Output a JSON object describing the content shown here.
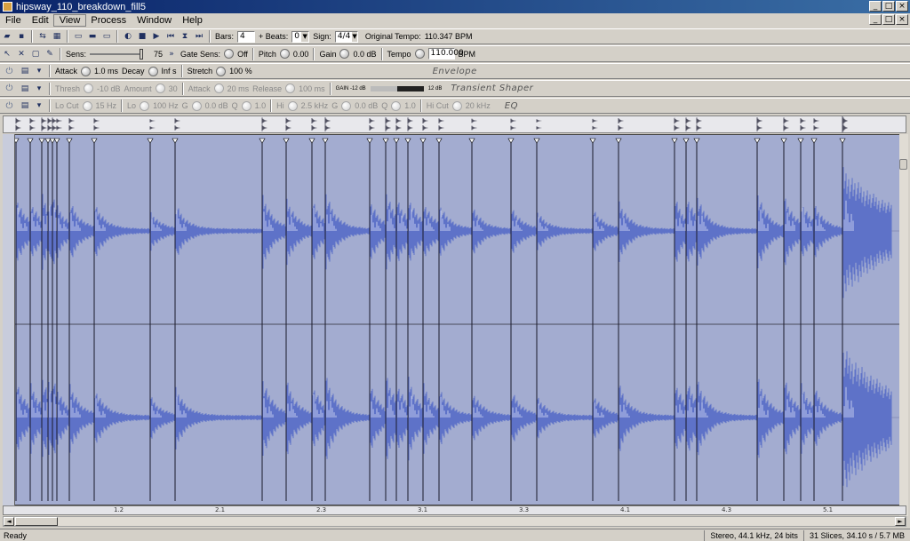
{
  "window": {
    "title": "hipsway_110_breakdown_fill5"
  },
  "menu": [
    "File",
    "Edit",
    "View",
    "Process",
    "Window",
    "Help"
  ],
  "toolbar1": {
    "bars_label": "Bars:",
    "bars_value": "4",
    "beats_label": "+ Beats:",
    "beats_value": "0",
    "sign_label": "Sign:",
    "sign_value": "4/4",
    "orig_tempo_label": "Original Tempo:",
    "orig_tempo_value": "110.347 BPM"
  },
  "toolbar2": {
    "sens_label": "Sens:",
    "sens_value": "75",
    "gate_label": "Gate Sens:",
    "gate_value": "Off",
    "pitch_label": "Pitch",
    "pitch_value": "0.00",
    "gain_label": "Gain",
    "gain_value": "0.0 dB",
    "tempo_label": "Tempo",
    "tempo_value": "110.000",
    "tempo_unit": "BPM"
  },
  "envelope": {
    "attack_label": "Attack",
    "attack_value": "1.0 ms",
    "decay_label": "Decay",
    "decay_value": "Inf s",
    "stretch_label": "Stretch",
    "stretch_value": "100 %",
    "section": "Envelope"
  },
  "transient": {
    "thresh_label": "Thresh",
    "thresh_value": "-10 dB",
    "amount_label": "Amount",
    "amount_value": "30",
    "attack_label": "Attack",
    "attack_value": "20 ms",
    "release_label": "Release",
    "release_value": "100 ms",
    "meter_left": "GAIN -12 dB",
    "meter_right": "12 dB",
    "section": "Transient Shaper"
  },
  "eq": {
    "locut_label": "Lo Cut",
    "locut_value": "15 Hz",
    "lo_label": "Lo",
    "lo_value": "100 Hz",
    "lo_g_label": "G",
    "lo_g_value": "0.0 dB",
    "lo_q_label": "Q",
    "lo_q_value": "1.0",
    "hi_label": "Hi",
    "hi_value": "2.5 kHz",
    "hi_g_label": "G",
    "hi_g_value": "0.0 dB",
    "hi_q_label": "Q",
    "hi_q_value": "1.0",
    "hicut_label": "Hi Cut",
    "hicut_value": "20 kHz",
    "section": "EQ"
  },
  "timeline": {
    "labels": [
      "1.2",
      "2.1",
      "2.3",
      "3.1",
      "3.3",
      "4.1",
      "4.3",
      "5.1"
    ]
  },
  "status": {
    "left": "Ready",
    "format": "Stereo, 44.1 kHz, 24 bits",
    "slices": "31 Slices, 34.10 s / 5.7 MB"
  },
  "colors": {
    "wave_bg": "#a3acd0",
    "wave": "#5e72c8",
    "wave_peak": "#d8ddf4",
    "slice_line": "#1a1a2a"
  }
}
